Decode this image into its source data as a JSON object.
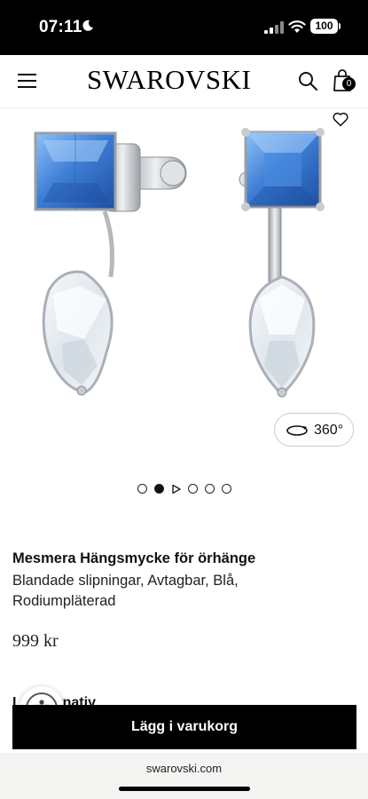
{
  "status_bar": {
    "time": "07:11",
    "battery": "100"
  },
  "header": {
    "logo": "SWAROVSKI",
    "cart_count": "0"
  },
  "gallery": {
    "view360_label": "360°",
    "slide_count": 6,
    "active_index": 1
  },
  "product": {
    "title": "Mesmera Hängsmycke för örhänge",
    "subtitle": "Blandade slipningar, Avtagbar, Blå, Rodiumpläterad",
    "price": "999 kr"
  },
  "options": {
    "partial_label": "L         salternativ"
  },
  "actions": {
    "add_to_cart": "Lägg i varukorg"
  },
  "browser": {
    "url": "swarovski.com"
  },
  "colors": {
    "stone_blue": "#3f7fd6",
    "stone_clear": "#e8eef2",
    "metal": "#c8ccd0",
    "button_black": "#000000"
  }
}
